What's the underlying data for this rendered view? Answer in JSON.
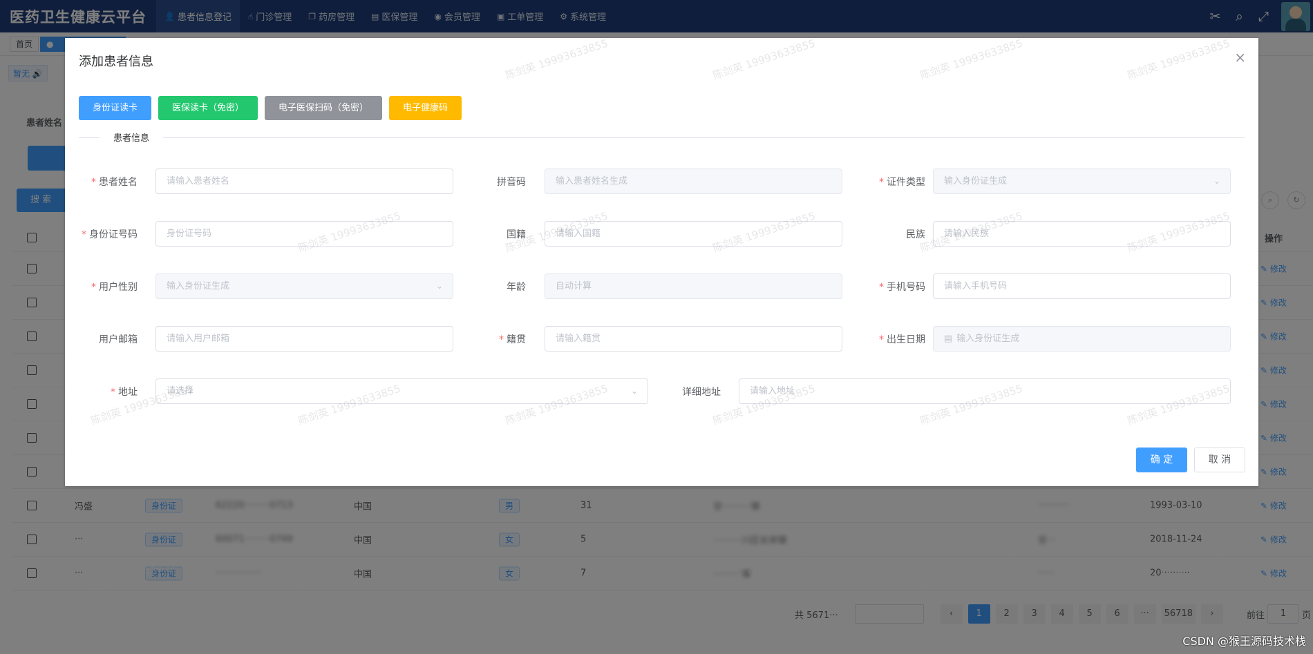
{
  "header": {
    "brand": "医药卫生健康云平台",
    "nav": [
      {
        "label": "患者信息登记",
        "icon": "user-icon",
        "glyph": "👤"
      },
      {
        "label": "门诊管理",
        "icon": "hand-icon",
        "glyph": "☝"
      },
      {
        "label": "药房管理",
        "icon": "copy-icon",
        "glyph": "❐"
      },
      {
        "label": "医保管理",
        "icon": "card-icon",
        "glyph": "▤"
      },
      {
        "label": "会员管理",
        "icon": "github-icon",
        "glyph": "◉"
      },
      {
        "label": "工单管理",
        "icon": "document-icon",
        "glyph": "▣"
      },
      {
        "label": "系统管理",
        "icon": "gear-icon",
        "glyph": "⚙"
      }
    ]
  },
  "tags": {
    "home": "首页"
  },
  "background": {
    "notice": "暂无",
    "search_label": "患者姓名",
    "search_button": "搜 索",
    "op_header": "操作",
    "edit_label": "修改",
    "rows": [
      {
        "name": "",
        "idtype": "",
        "idno": "",
        "nation": "",
        "sex": "",
        "age": "",
        "addr": "",
        "phone": "",
        "birth": ""
      },
      {
        "name": "",
        "idtype": "",
        "idno": "",
        "nation": "",
        "sex": "",
        "age": "",
        "addr": "",
        "phone": "",
        "birth": ""
      },
      {
        "name": "",
        "idtype": "",
        "idno": "",
        "nation": "",
        "sex": "",
        "age": "",
        "addr": "",
        "phone": "",
        "birth": ""
      },
      {
        "name": "",
        "idtype": "",
        "idno": "",
        "nation": "",
        "sex": "",
        "age": "",
        "addr": "",
        "phone": "",
        "birth": ""
      },
      {
        "name": "",
        "idtype": "",
        "idno": "",
        "nation": "",
        "sex": "",
        "age": "",
        "addr": "",
        "phone": "",
        "birth": ""
      },
      {
        "name": "",
        "idtype": "",
        "idno": "",
        "nation": "",
        "sex": "",
        "age": "",
        "addr": "",
        "phone": "",
        "birth": ""
      },
      {
        "name": "",
        "idtype": "",
        "idno": "",
        "nation": "",
        "sex": "",
        "age": "",
        "addr": "",
        "phone": "",
        "birth": ""
      },
      {
        "name": "冯盛",
        "idtype": "身份证",
        "idno": "62220·········0713",
        "nation": "中国",
        "sex": "男",
        "age": "31",
        "addr": "甘··········镇",
        "phone": "···········",
        "birth": "1993-03-10"
      },
      {
        "name": "···",
        "idtype": "身份证",
        "idno": "60071·········0749",
        "nation": "中国",
        "sex": "女",
        "age": "5",
        "addr": "··········川区长宋镇",
        "phone": "甘···",
        "birth": "2018-11-24"
      },
      {
        "name": "···",
        "idtype": "身份证",
        "idno": "················",
        "nation": "中国",
        "sex": "女",
        "age": "7",
        "addr": "··········镇",
        "phone": "······",
        "birth": "20··········"
      }
    ],
    "pager": {
      "total": "共 5671···",
      "pages": [
        "1",
        "2",
        "3",
        "4",
        "5",
        "6",
        "···",
        "56718"
      ],
      "goto_label": "前往",
      "goto_value": "1",
      "page_unit": "页"
    }
  },
  "dialog": {
    "title": "添加患者信息",
    "read_buttons": [
      "身份证读卡",
      "医保读卡（免密）",
      "电子医保扫码（免密）",
      "电子健康码"
    ],
    "section": "患者信息",
    "fields": {
      "name": {
        "label": "患者姓名",
        "placeholder": "请输入患者姓名"
      },
      "pinyin": {
        "label": "拼音码",
        "placeholder": "输入患者姓名生成"
      },
      "idtype": {
        "label": "证件类型",
        "placeholder": "输入身份证生成"
      },
      "idno": {
        "label": "身份证号码",
        "placeholder": "身份证号码"
      },
      "nationality": {
        "label": "国籍",
        "placeholder": "请输入国籍"
      },
      "ethnicity": {
        "label": "民族",
        "placeholder": "请输入民族"
      },
      "gender": {
        "label": "用户性别",
        "placeholder": "输入身份证生成"
      },
      "age": {
        "label": "年龄",
        "placeholder": "自动计算"
      },
      "phone": {
        "label": "手机号码",
        "placeholder": "请输入手机号码"
      },
      "email": {
        "label": "用户邮箱",
        "placeholder": "请输入用户邮箱"
      },
      "origin": {
        "label": "籍贯",
        "placeholder": "请输入籍贯"
      },
      "birth": {
        "label": "出生日期",
        "placeholder": "输入身份证生成"
      },
      "address": {
        "label": "地址",
        "placeholder": "请选择"
      },
      "detail": {
        "label": "详细地址",
        "placeholder": "请输入地址"
      }
    },
    "ok": "确 定",
    "cancel": "取 消"
  },
  "watermark": "陈剑英 19993633855",
  "footer_credit": "CSDN @猴王源码技术栈"
}
